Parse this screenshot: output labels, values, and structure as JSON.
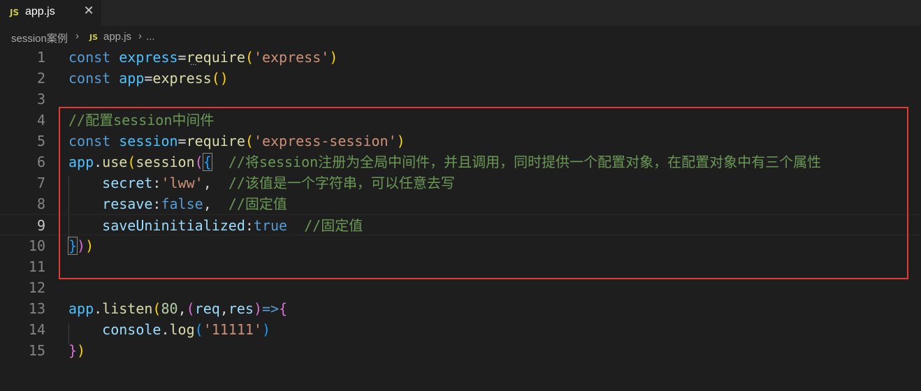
{
  "tab": {
    "badge": "JS",
    "label": "app.js",
    "close": "✕"
  },
  "breadcrumb": {
    "folder": "session案例",
    "sep": "›",
    "badge": "JS",
    "file": "app.js",
    "more": "..."
  },
  "lines": [
    {
      "n": "1",
      "tokens": [
        {
          "t": "const ",
          "c": "kw"
        },
        {
          "t": "express",
          "c": "var"
        },
        {
          "t": "=",
          "c": "plain"
        },
        {
          "t": "require",
          "c": "fn"
        },
        {
          "t": "(",
          "c": "b1"
        },
        {
          "t": "'express'",
          "c": "str"
        },
        {
          "t": ")",
          "c": "b1"
        }
      ]
    },
    {
      "n": "2",
      "tokens": [
        {
          "t": "const ",
          "c": "kw"
        },
        {
          "t": "app",
          "c": "var"
        },
        {
          "t": "=",
          "c": "plain"
        },
        {
          "t": "express",
          "c": "fn"
        },
        {
          "t": "()",
          "c": "b1"
        }
      ]
    },
    {
      "n": "3",
      "tokens": []
    },
    {
      "n": "4",
      "tokens": [
        {
          "t": "//配置session中间件",
          "c": "cm"
        }
      ]
    },
    {
      "n": "5",
      "tokens": [
        {
          "t": "const ",
          "c": "kw"
        },
        {
          "t": "session",
          "c": "var"
        },
        {
          "t": "=",
          "c": "plain"
        },
        {
          "t": "require",
          "c": "fn"
        },
        {
          "t": "(",
          "c": "b1"
        },
        {
          "t": "'express-session'",
          "c": "str"
        },
        {
          "t": ")",
          "c": "b1"
        }
      ]
    },
    {
      "n": "6",
      "tokens": [
        {
          "t": "app",
          "c": "var"
        },
        {
          "t": ".",
          "c": "plain"
        },
        {
          "t": "use",
          "c": "fn"
        },
        {
          "t": "(",
          "c": "b1"
        },
        {
          "t": "session",
          "c": "fn"
        },
        {
          "t": "(",
          "c": "b2"
        },
        {
          "t": "{",
          "c": "b3 bracket-match"
        },
        {
          "t": "  //将session注册为全局中间件，并且调用，同时提供一个配置对象，在配置对象中有三个属性",
          "c": "cm"
        }
      ]
    },
    {
      "n": "7",
      "tokens": [
        {
          "t": "    ",
          "c": "plain"
        },
        {
          "t": "secret",
          "c": "prop"
        },
        {
          "t": ":",
          "c": "plain"
        },
        {
          "t": "'lww'",
          "c": "str"
        },
        {
          "t": ",  ",
          "c": "plain"
        },
        {
          "t": "//该值是一个字符串，可以任意去写",
          "c": "cm"
        }
      ]
    },
    {
      "n": "8",
      "tokens": [
        {
          "t": "    ",
          "c": "plain"
        },
        {
          "t": "resave",
          "c": "prop"
        },
        {
          "t": ":",
          "c": "plain"
        },
        {
          "t": "false",
          "c": "kw"
        },
        {
          "t": ",  ",
          "c": "plain"
        },
        {
          "t": "//固定值",
          "c": "cm"
        }
      ]
    },
    {
      "n": "9",
      "tokens": [
        {
          "t": "    ",
          "c": "plain"
        },
        {
          "t": "saveUninitialized",
          "c": "prop"
        },
        {
          "t": ":",
          "c": "plain"
        },
        {
          "t": "true",
          "c": "kw"
        },
        {
          "t": "  ",
          "c": "plain"
        },
        {
          "t": "//固定值",
          "c": "cm"
        }
      ]
    },
    {
      "n": "10",
      "tokens": [
        {
          "t": "}",
          "c": "b3 bracket-match"
        },
        {
          "t": ")",
          "c": "b2"
        },
        {
          "t": ")",
          "c": "b1"
        }
      ]
    },
    {
      "n": "11",
      "tokens": []
    },
    {
      "n": "12",
      "tokens": []
    },
    {
      "n": "13",
      "tokens": [
        {
          "t": "app",
          "c": "var"
        },
        {
          "t": ".",
          "c": "plain"
        },
        {
          "t": "listen",
          "c": "fn"
        },
        {
          "t": "(",
          "c": "b1"
        },
        {
          "t": "80",
          "c": "num"
        },
        {
          "t": ",",
          "c": "plain"
        },
        {
          "t": "(",
          "c": "b2"
        },
        {
          "t": "req",
          "c": "param"
        },
        {
          "t": ",",
          "c": "plain"
        },
        {
          "t": "res",
          "c": "param"
        },
        {
          "t": ")",
          "c": "b2"
        },
        {
          "t": "=>",
          "c": "kw"
        },
        {
          "t": "{",
          "c": "b2"
        }
      ]
    },
    {
      "n": "14",
      "tokens": [
        {
          "t": "    ",
          "c": "plain"
        },
        {
          "t": "console",
          "c": "prop"
        },
        {
          "t": ".",
          "c": "plain"
        },
        {
          "t": "log",
          "c": "fn"
        },
        {
          "t": "(",
          "c": "b3"
        },
        {
          "t": "'11111'",
          "c": "str"
        },
        {
          "t": ")",
          "c": "b3"
        }
      ]
    },
    {
      "n": "15",
      "tokens": [
        {
          "t": "}",
          "c": "b2"
        },
        {
          "t": ")",
          "c": "b1"
        }
      ]
    }
  ],
  "active_line": "9",
  "colors": {
    "background": "#1e1e1e",
    "highlight_box": "#e53935",
    "keyword": "#569cd6",
    "comment": "#6a9955",
    "string": "#ce9178",
    "function": "#dcdcaa"
  }
}
